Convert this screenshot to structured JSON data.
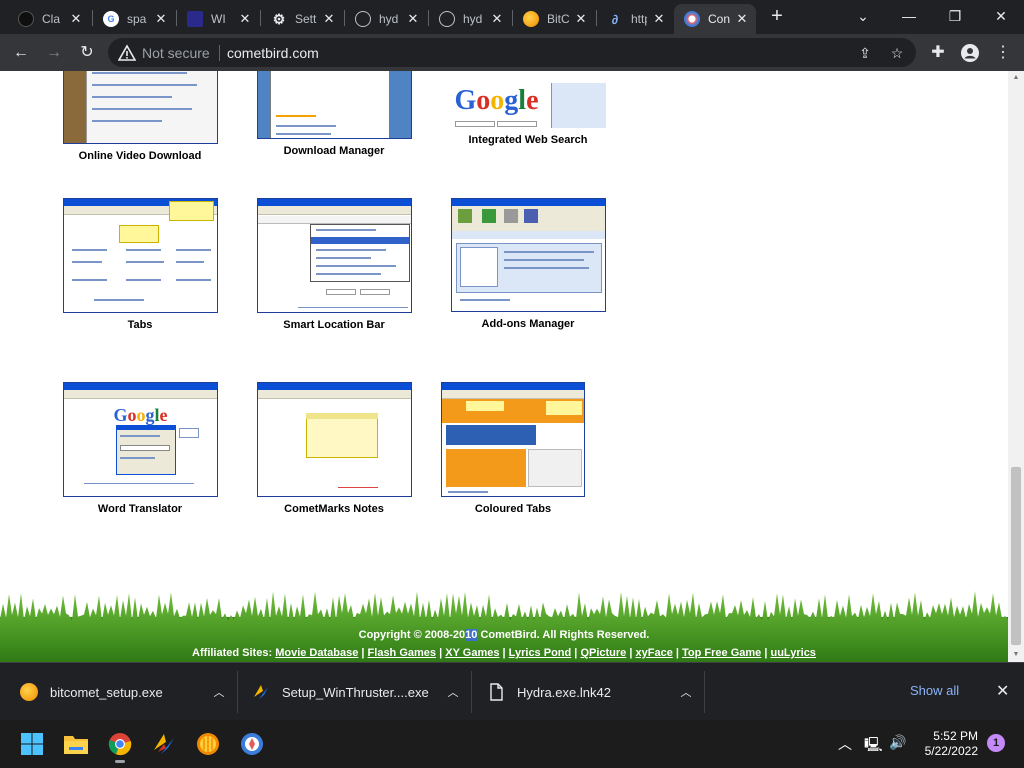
{
  "tabs": [
    {
      "title": "Cla",
      "icon": "claude-icon"
    },
    {
      "title": "spa",
      "icon": "google-icon"
    },
    {
      "title": "WI",
      "icon": "winthruster-icon"
    },
    {
      "title": "Sett",
      "icon": "gear-icon"
    },
    {
      "title": "hyd",
      "icon": "globe-icon"
    },
    {
      "title": "hyd",
      "icon": "globe-icon"
    },
    {
      "title": "BitC",
      "icon": "bitcomet-icon"
    },
    {
      "title": "http",
      "icon": "link-icon"
    },
    {
      "title": "Con",
      "icon": "cometbird-icon",
      "active": true
    }
  ],
  "address_bar": {
    "security_label": "Not secure",
    "url": "cometbird.com"
  },
  "features": [
    {
      "caption": "Online Video Download"
    },
    {
      "caption": "Download Manager"
    },
    {
      "caption": "Integrated Web Search"
    },
    {
      "caption": "Tabs"
    },
    {
      "caption": "Smart Location Bar"
    },
    {
      "caption": "Add-ons Manager"
    },
    {
      "caption": "Word Translator"
    },
    {
      "caption": "CometMarks Notes"
    },
    {
      "caption": "Coloured Tabs"
    }
  ],
  "footer": {
    "copyright_before": "Copyright © 2008-20",
    "copyright_highlight": "10",
    "copyright_after": " CometBird. All Rights Reserved.",
    "affiliates_label": "Affiliated Sites:",
    "affiliate_links": [
      "Movie Database",
      "Flash Games",
      "XY Games",
      "Lyrics Pond",
      "QPicture",
      "xyFace",
      "Top Free Game",
      "uuLyrics"
    ]
  },
  "downloads": [
    {
      "filename": "bitcomet_setup.exe",
      "icon": "bitcomet-icon"
    },
    {
      "filename": "Setup_WinThruster....exe",
      "icon": "winthruster-icon"
    },
    {
      "filename": "Hydra.exe.lnk42",
      "icon": "file-icon"
    }
  ],
  "download_shelf": {
    "show_all_label": "Show all"
  },
  "taskbar": {
    "time": "5:52 PM",
    "date": "5/22/2022",
    "notification_count": "1"
  },
  "colors": {
    "browser_dark": "#202124",
    "toolbar": "#35363a",
    "grass": "#3f8f1f",
    "link_blue": "#8ab4f8"
  }
}
